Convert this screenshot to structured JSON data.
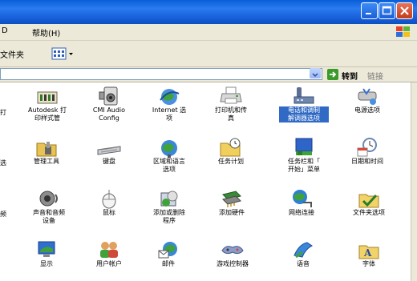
{
  "titlebar": {
    "color": "#0a5ed8"
  },
  "menu": {
    "items": [
      {
        "label": "D"
      },
      {
        "label": "帮助(H)"
      }
    ]
  },
  "toolbar": {
    "folders_label": "文件夹"
  },
  "address": {
    "go_label": "转到",
    "links_label": "链接"
  },
  "edge_labels": [
    "打",
    "选",
    "频"
  ],
  "grid": {
    "row1": [
      {
        "label": "Autodesk 打\n印样式管",
        "icon": "autodesk-icon"
      },
      {
        "label": "CMI Audio\nConfig",
        "icon": "audio-config-icon"
      },
      {
        "label": "Internet 选\n项",
        "icon": "internet-options-icon"
      },
      {
        "label": "打印机和传\n真",
        "icon": "printer-icon"
      },
      {
        "label": "电话和调制\n解调器选项",
        "icon": "phone-modem-icon",
        "selected": true
      },
      {
        "label": "电源选项",
        "icon": "power-options-icon"
      }
    ],
    "row2": [
      {
        "label": "管理工具",
        "icon": "admin-tools-icon"
      },
      {
        "label": "键盘",
        "icon": "keyboard-icon"
      },
      {
        "label": "区域和语言\n选项",
        "icon": "region-language-icon"
      },
      {
        "label": "任务计划",
        "icon": "scheduled-tasks-icon"
      },
      {
        "label": "任务栏和「\n开始」菜单",
        "icon": "taskbar-start-icon"
      },
      {
        "label": "日期和时间",
        "icon": "date-time-icon"
      }
    ],
    "row3": [
      {
        "label": "声音和音频\n设备",
        "icon": "sound-audio-icon"
      },
      {
        "label": "鼠标",
        "icon": "mouse-icon"
      },
      {
        "label": "添加或删除\n程序",
        "icon": "add-remove-programs-icon"
      },
      {
        "label": "添加硬件",
        "icon": "add-hardware-icon"
      },
      {
        "label": "网络连接",
        "icon": "network-connections-icon"
      },
      {
        "label": "文件夹选项",
        "icon": "folder-options-icon"
      }
    ],
    "row4": [
      {
        "label": "显示",
        "icon": "display-icon"
      },
      {
        "label": "用户帐户",
        "icon": "user-accounts-icon"
      },
      {
        "label": "邮件",
        "icon": "mail-icon"
      },
      {
        "label": "游戏控制器",
        "icon": "game-controller-icon"
      },
      {
        "label": "语音",
        "icon": "speech-icon"
      },
      {
        "label": "字体",
        "icon": "fonts-icon"
      }
    ]
  },
  "colors": {
    "selection": "#316ac5",
    "chrome": "#ece9d8"
  }
}
